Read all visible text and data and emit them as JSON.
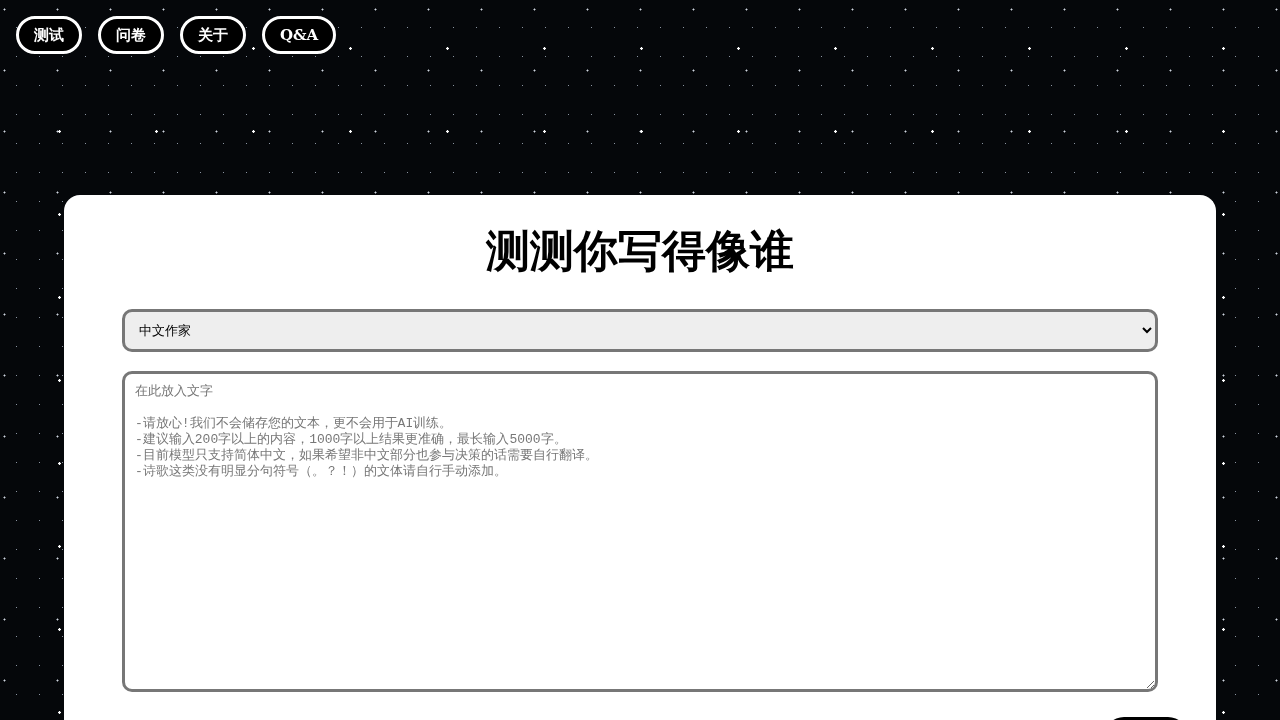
{
  "nav": [
    {
      "label": "测试"
    },
    {
      "label": "问卷"
    },
    {
      "label": "关于"
    },
    {
      "label": "Q&A"
    }
  ],
  "title": "测测你写得像谁",
  "category_select": {
    "value": "中文作家"
  },
  "text_input": {
    "placeholder": "在此放入文字\n\n-请放心!我们不会储存您的文本，更不会用于AI训练。\n-建议输入200字以上的内容，1000字以上结果更准确，最长输入5000字。\n-目前模型只支持简体中文，如果希望非中文部分也参与决策的话需要自行翻译。\n-诗歌这类没有明显分句符号（。？！）的文体请自行手动添加。"
  }
}
